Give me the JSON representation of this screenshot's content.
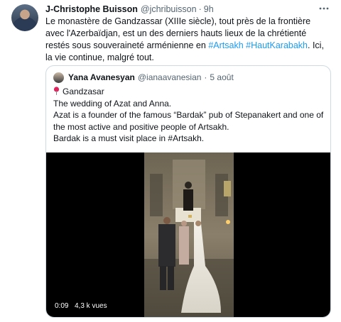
{
  "tweet": {
    "author_name": "J-Christophe Buisson",
    "handle": "@jchribuisson",
    "separator": "·",
    "time": "9h",
    "text_1": "Le monastère de Gandzassar (XIIIe siècle), tout près de la frontière avec l'Azerbaïdjan, est un des derniers hauts lieux de la chrétienté restés sous souveraineté arménienne en ",
    "hashtag_1": "#Artsakh",
    "hashtag_2": "#HautKarabakh",
    "text_2": ". Ici, la vie continue, malgré tout.",
    "more_icon": "more-horizontal-icon"
  },
  "quoted": {
    "author_name": "Yana Avanesyan",
    "handle": "@ianaavanesian",
    "separator": "·",
    "time": "5 août",
    "location": "Gandzasar",
    "line_1": "The wedding of Azat and Anna.",
    "line_2": "Azat is a founder of the famous “Bardak” pub of Stepanakert and one of the most active and positive people of Artsakh.",
    "line_3": "Bardak is a must visit place in #Artsakh.",
    "video": {
      "elapsed": "0:09",
      "views": "4,3 k vues"
    }
  },
  "colors": {
    "link": "#1d9bf0",
    "text": "#0f1419",
    "secondary": "#536471",
    "border": "#cfd9de",
    "pin": "#e0245e"
  }
}
